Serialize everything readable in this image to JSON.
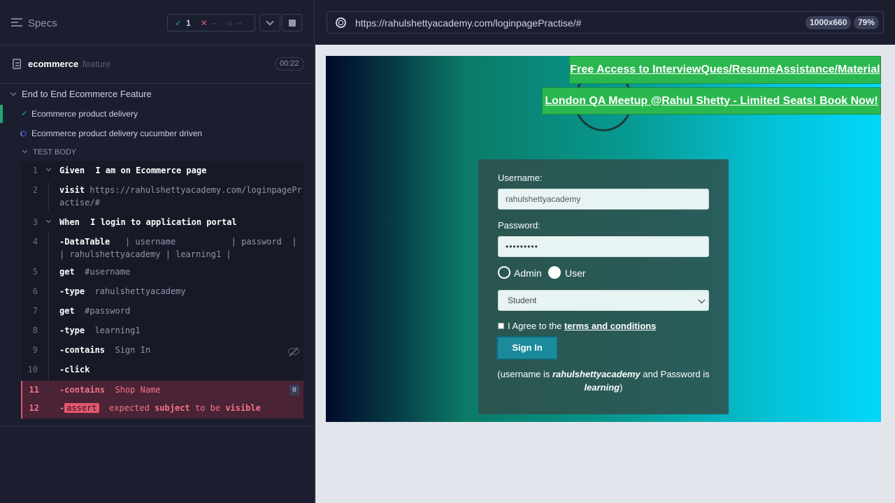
{
  "reporter": {
    "specs_label": "Specs",
    "stats": {
      "passed": "1",
      "failed": "--",
      "pending": "--"
    },
    "file": {
      "name": "ecommerce",
      "ext": ".feature",
      "duration": "00:22"
    },
    "suite_title": "End to End Ecommerce Feature",
    "tests": [
      {
        "title": "Ecommerce product delivery",
        "state": "passed"
      },
      {
        "title": "Ecommerce product delivery cucumber driven",
        "state": "running"
      }
    ],
    "test_body_label": "TEST BODY",
    "commands": [
      {
        "n": "1",
        "name": "Given",
        "arg": " I am on Ecommerce page"
      },
      {
        "n": "2",
        "name": "visit",
        "arg": "https://rahulshettyacademy.com/loginpagePr",
        "arg2": "actise/#"
      },
      {
        "n": "3",
        "name": "When",
        "arg": " I login to application portal"
      },
      {
        "n": "4",
        "name": "-DataTable",
        "arg": "| username           | password  |",
        "arg2": "| rahulshettyacademy | learning1 |"
      },
      {
        "n": "5",
        "name": "get",
        "arg": "#username"
      },
      {
        "n": "6",
        "name": "-type",
        "arg": "rahulshettyacademy"
      },
      {
        "n": "7",
        "name": "get",
        "arg": "#password"
      },
      {
        "n": "8",
        "name": "-type",
        "arg": "learning1"
      },
      {
        "n": "9",
        "name": "-contains",
        "arg": "Sign In"
      },
      {
        "n": "10",
        "name": "-click",
        "arg": ""
      },
      {
        "n": "11",
        "name": "-contains",
        "arg": "Shop Name",
        "badge": "0"
      },
      {
        "n": "12",
        "name": "-",
        "tag": "assert",
        "arg": "expected",
        "arg2": "subject",
        "arg3": "to be",
        "arg4": "visible"
      }
    ]
  },
  "aut": {
    "url": "https://rahulshettyacademy.com/loginpagePractise/#",
    "viewport": "1000x660",
    "zoom": "79%",
    "promos": [
      "Free Access to InterviewQues/ResumeAssistance/Material",
      "London QA Meetup @Rahul Shetty - Limited Seats! Book Now!"
    ],
    "form": {
      "username_label": "Username:",
      "username_value": "rahulshettyacademy",
      "password_label": "Password:",
      "password_value": "•••••••••",
      "radio_admin": "Admin",
      "radio_user": "User",
      "select_value": "Student",
      "terms_prefix": "I Agree to the",
      "terms_link": "terms and conditions",
      "signin": "Sign In",
      "hint_a": "(username is",
      "hint_user": "rahulshettyacademy",
      "hint_b": "and Password is",
      "hint_pass": "learning",
      "hint_c": ")"
    }
  },
  "colors": {
    "pass": "#1fa971",
    "fail": "#e45770",
    "promo": "#2bb74f",
    "signin": "#1b8b9c"
  }
}
